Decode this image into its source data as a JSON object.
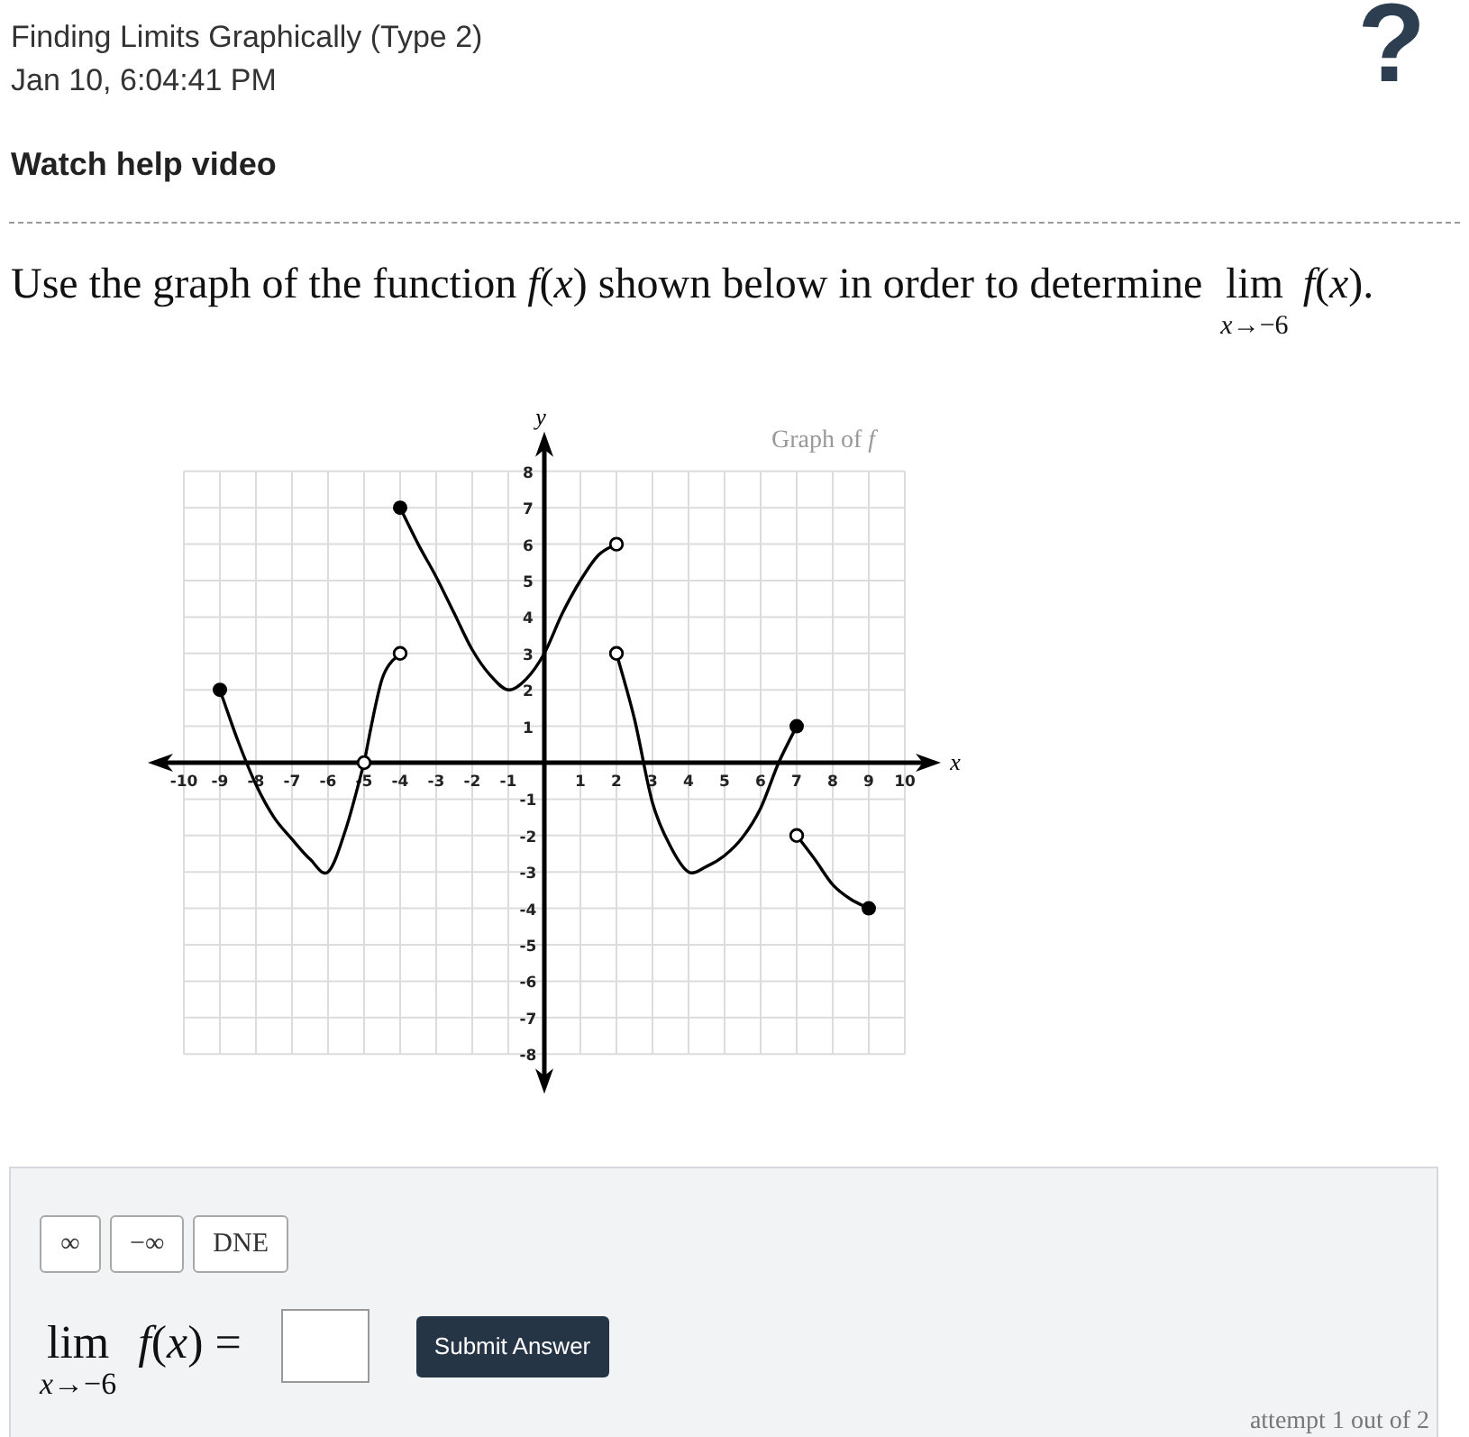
{
  "header": {
    "title": "Finding Limits Graphically (Type 2)",
    "timestamp": "Jan 10, 6:04:41 PM",
    "help_link": "Watch help video",
    "help_button": "?"
  },
  "question": {
    "text": "Use the graph of the function *f*(*x*) shown below in order to determine",
    "limit": {
      "operator": "lim",
      "subscript": "*x*→−6",
      "expression": "*f*(*x*)."
    }
  },
  "graph": {
    "chart_data": {
      "type": "line",
      "title": "Graph of *f*",
      "xlabel": "x",
      "ylabel": "y",
      "grid": true,
      "x": [
        -9,
        -8.5,
        -8,
        -7.5,
        -7,
        -6.5,
        -6,
        -5.5,
        -5,
        -4.5,
        -4,
        -3.5,
        -3,
        -2.5,
        -2,
        -1.5,
        -1,
        -0.5,
        0,
        0.5,
        1,
        1.5,
        2,
        2.5,
        3,
        3.5,
        4,
        4.5,
        5,
        5.5,
        6,
        6.5,
        7,
        7.5,
        8,
        8.5,
        9
      ],
      "series": [
        {
          "color": "#000000",
          "values": [
            2,
            0.6,
            -0.6,
            -1.5,
            -2.1,
            -2.65,
            -3,
            -1.8,
            0,
            null,
            null,
            null,
            null,
            null,
            null,
            null,
            null,
            null,
            null,
            null,
            null,
            null,
            null,
            null,
            null,
            null,
            null,
            null,
            null,
            null,
            null,
            null,
            null,
            null,
            null,
            null,
            null
          ]
        },
        {
          "color": "#000000",
          "values": [
            null,
            null,
            null,
            null,
            null,
            null,
            null,
            null,
            0,
            2.3,
            3,
            null,
            null,
            null,
            null,
            null,
            null,
            null,
            null,
            null,
            null,
            null,
            null,
            null,
            null,
            null,
            null,
            null,
            null,
            null,
            null,
            null,
            null,
            null,
            null,
            null,
            null
          ]
        },
        {
          "color": "#000000",
          "values": [
            null,
            null,
            null,
            null,
            null,
            null,
            null,
            null,
            null,
            null,
            7,
            6,
            5.1,
            4.1,
            3.1,
            2.4,
            2,
            2.3,
            3,
            4.1,
            5,
            5.7,
            6,
            null,
            null,
            null,
            null,
            null,
            null,
            null,
            null,
            null,
            null,
            null,
            null,
            null,
            null
          ]
        },
        {
          "color": "#000000",
          "values": [
            null,
            null,
            null,
            null,
            null,
            null,
            null,
            null,
            null,
            null,
            null,
            null,
            null,
            null,
            null,
            null,
            null,
            null,
            null,
            null,
            null,
            null,
            3,
            1.2,
            -1.1,
            -2.3,
            -3,
            -2.85,
            -2.55,
            -2.05,
            -1.25,
            0,
            1,
            null,
            null,
            null,
            null
          ]
        },
        {
          "color": "#000000",
          "values": [
            null,
            null,
            null,
            null,
            null,
            null,
            null,
            null,
            null,
            null,
            null,
            null,
            null,
            null,
            null,
            null,
            null,
            null,
            null,
            null,
            null,
            null,
            null,
            null,
            null,
            null,
            null,
            null,
            null,
            null,
            null,
            null,
            -2,
            -2.65,
            -3.35,
            -3.75,
            -4
          ]
        }
      ],
      "xlim": [
        -10,
        10
      ],
      "ylim": [
        -8,
        8
      ],
      "xticks": [
        -10,
        -9,
        -8,
        -7,
        -6,
        -5,
        -4,
        -3,
        -2,
        -1,
        1,
        2,
        3,
        4,
        5,
        6,
        7,
        8,
        9,
        10
      ],
      "yticks": [
        -8,
        -7,
        -6,
        -5,
        -4,
        -3,
        -2,
        -1,
        1,
        2,
        3,
        4,
        5,
        6,
        7,
        8
      ]
    },
    "curve_ends": [
      {
        "start_filled": true,
        "end_filled": false
      },
      {
        "end_filled": false
      },
      {
        "start_filled": true,
        "end_filled": false
      },
      {
        "start_filled": false,
        "end_filled": true
      },
      {
        "start_filled": false,
        "end_filled": true
      }
    ]
  },
  "answer_panel": {
    "special_buttons": [
      "∞",
      "−∞",
      "DNE"
    ],
    "limit": {
      "operator": "lim",
      "subscript": "*x*→−6",
      "expression": "*f*(*x*) ="
    },
    "submit_button": "Submit Answer",
    "attempt": "attempt 1 out of 2"
  }
}
